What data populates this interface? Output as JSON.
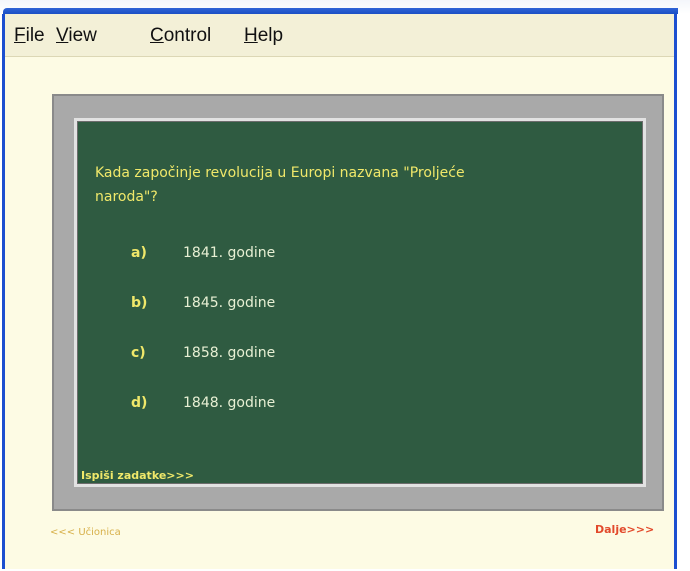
{
  "menu": {
    "file": {
      "first": "F",
      "rest": "ile"
    },
    "view": {
      "first": "V",
      "rest": "iew"
    },
    "control": {
      "first": "C",
      "rest": "ontrol"
    },
    "help": {
      "first": "H",
      "rest": "elp"
    }
  },
  "quiz": {
    "question_line1": "Kada započinje revolucija u Europi nazvana \"Proljeće",
    "question_line2": "naroda\"?",
    "answers": [
      {
        "letter": "a)",
        "text": "1841. godine"
      },
      {
        "letter": "b)",
        "text": "1845. godine"
      },
      {
        "letter": "c)",
        "text": "1858. godine"
      },
      {
        "letter": "d)",
        "text": "1848. godine"
      }
    ],
    "print_label": "Ispiši zadatke>>>"
  },
  "nav": {
    "back_label": "<<< Učionica",
    "next_label": "Dalje>>>"
  },
  "colors": {
    "board": "#2f5b41",
    "chalk_yellow": "#f0e86a",
    "window_bg": "#fdfbe4",
    "next_red": "#e2492b"
  }
}
